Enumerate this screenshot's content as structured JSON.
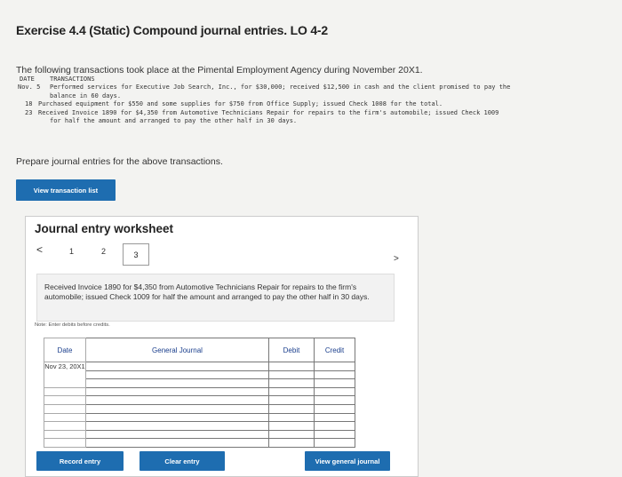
{
  "title": "Exercise 4.4 (Static) Compound journal entries. LO 4-2",
  "intro": "The following transactions took place at the Pimental Employment Agency during November 20X1.",
  "transactions": {
    "header_date": "DATE",
    "header_tx": "TRANSACTIONS",
    "lines": [
      {
        "date": "Nov.  5",
        "text": "Performed services for Executive Job Search, Inc., for $30,000; received $12,500 in cash and the client promised to pay the"
      },
      {
        "date": "",
        "text": "balance in 60 days."
      },
      {
        "date": "18",
        "text": "Purchased equipment for $550 and some supplies for $750 from Office Supply; issued Check 1008 for the total."
      },
      {
        "date": "23",
        "text": "Received Invoice 1890 for $4,350 from Automotive Technicians Repair for repairs to the firm's automobile; issued Check 1009"
      },
      {
        "date": "",
        "text": "for half the amount and arranged to pay the other half in 30 days."
      }
    ]
  },
  "prepare": "Prepare journal entries for the above transactions.",
  "buttons": {
    "view_transaction_list": "View transaction list",
    "record_entry": "Record entry",
    "clear_entry": "Clear entry",
    "view_general_journal": "View general journal"
  },
  "worksheet": {
    "title": "Journal entry worksheet",
    "prev": "<",
    "next": ">",
    "pages": [
      "1",
      "2",
      "3"
    ],
    "description": "Received Invoice 1890 for $4,350 from Automotive Technicians Repair for repairs to the firm's automobile; issued Check 1009 for half the amount and arranged to pay the other half in 30 days.",
    "note": "Note: Enter debits before credits.",
    "columns": {
      "date": "Date",
      "account": "General Journal",
      "debit": "Debit",
      "credit": "Credit"
    },
    "date_value": "Nov 23, 20X1"
  },
  "colors": {
    "accent": "#1e6db0",
    "header_text": "#1a3e8c"
  }
}
